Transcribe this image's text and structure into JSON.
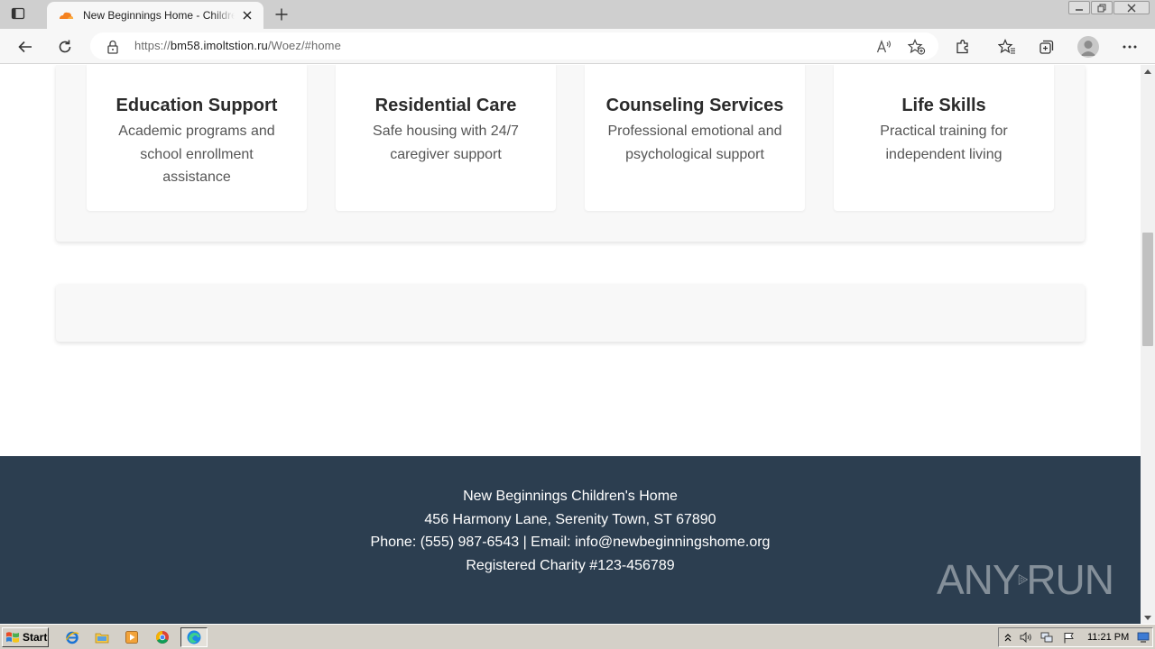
{
  "browser": {
    "tab_title": "New Beginnings Home - Children's Home",
    "url_scheme": "https://",
    "url_host": "bm58.imoltstion.ru",
    "url_path": "/Woez/#home"
  },
  "services": [
    {
      "title": "Education Support",
      "description": "Academic programs and school enrollment assistance"
    },
    {
      "title": "Residential Care",
      "description": "Safe housing with 24/7 caregiver support"
    },
    {
      "title": "Counseling Services",
      "description": "Professional emotional and psychological support"
    },
    {
      "title": "Life Skills",
      "description": "Practical training for independent living"
    }
  ],
  "footer": {
    "org_name": "New Beginnings Children's Home",
    "address": "456 Harmony Lane, Serenity Town, ST 67890",
    "contact": "Phone: (555) 987-6543 | Email: info@newbeginningshome.org",
    "charity": "Registered Charity #123-456789"
  },
  "watermark": {
    "left": "ANY",
    "right": "RUN"
  },
  "taskbar": {
    "start_label": "Start",
    "clock": "11:21 PM",
    "pinned": [
      "ie-icon",
      "folder-icon",
      "media-player-icon",
      "chrome-icon",
      "edge-icon"
    ]
  },
  "colors": {
    "footer_bg": "#2c3e50",
    "panel_bg": "#f8f8f8",
    "card_bg": "#ffffff",
    "tab_favicon": "#f48120"
  }
}
